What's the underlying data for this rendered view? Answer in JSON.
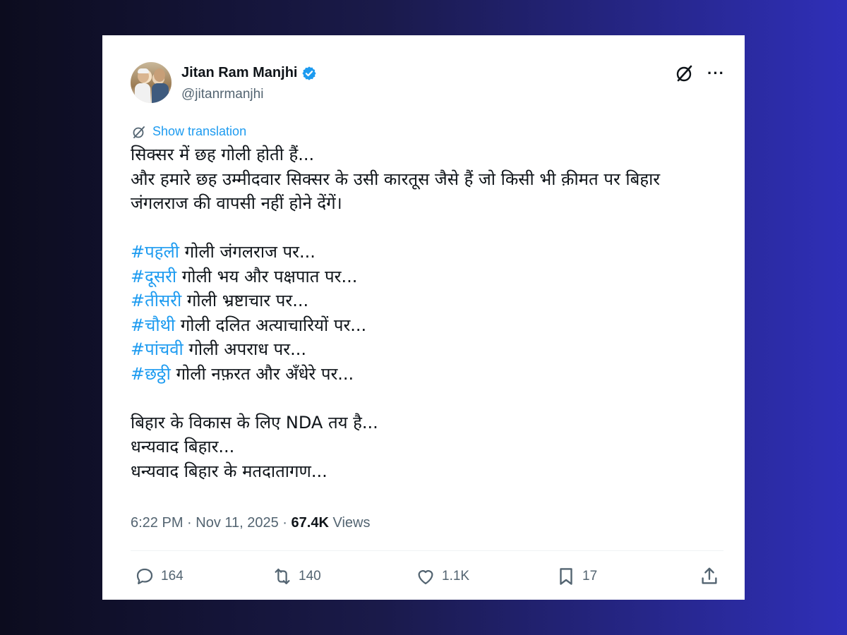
{
  "tweet": {
    "author_name": "Jitan Ram Manjhi",
    "handle": "@jitanrmanjhi",
    "show_translation": "Show translation",
    "lines": {
      "l1": "सिक्सर में छह गोली होती हैं...",
      "l2": "और हमारे छह उम्मीदवार सिक्सर के उसी कारतूस जैसे हैं जो किसी भी क़ीमत पर बिहार",
      "l3": "जंगलराज की वापसी नहीं होने देंगें।",
      "h1_tag": "#पहली",
      "h1_rest": " गोली जंगलराज पर...",
      "h2_tag": "#दूसरी",
      "h2_rest": " गोली भय और पक्षपात पर...",
      "h3_tag": "#तीसरी",
      "h3_rest": " गोली भ्रष्टाचार पर...",
      "h4_tag": "#चौथी",
      "h4_rest": " गोली दलित अत्याचारियों पर...",
      "h5_tag": "#पांचवी",
      "h5_rest": " गोली अपराध पर...",
      "h6_tag": "#छठ्ठी",
      "h6_rest": " गोली नफ़रत और अँधेरे पर...",
      "c1": "बिहार के विकास के लिए NDA तय है...",
      "c2": "धन्यवाद बिहार...",
      "c3": "धन्यवाद बिहार के मतदातागण..."
    },
    "meta_time": "6:22 PM · Nov 11, 2025 · ",
    "views_count": "67.4K",
    "views_label": " Views",
    "replies": "164",
    "reposts": "140",
    "likes": "1.1K",
    "bookmarks": "17"
  },
  "icons": {
    "verified": "verified-badge-icon",
    "grok": "grok-icon",
    "more": "more-icon",
    "reply": "reply-icon",
    "repost": "repost-icon",
    "like": "like-icon",
    "bookmark": "bookmark-icon",
    "share": "share-icon"
  },
  "colors": {
    "accent": "#1d9bf0",
    "text": "#0f1419",
    "muted": "#536471"
  }
}
